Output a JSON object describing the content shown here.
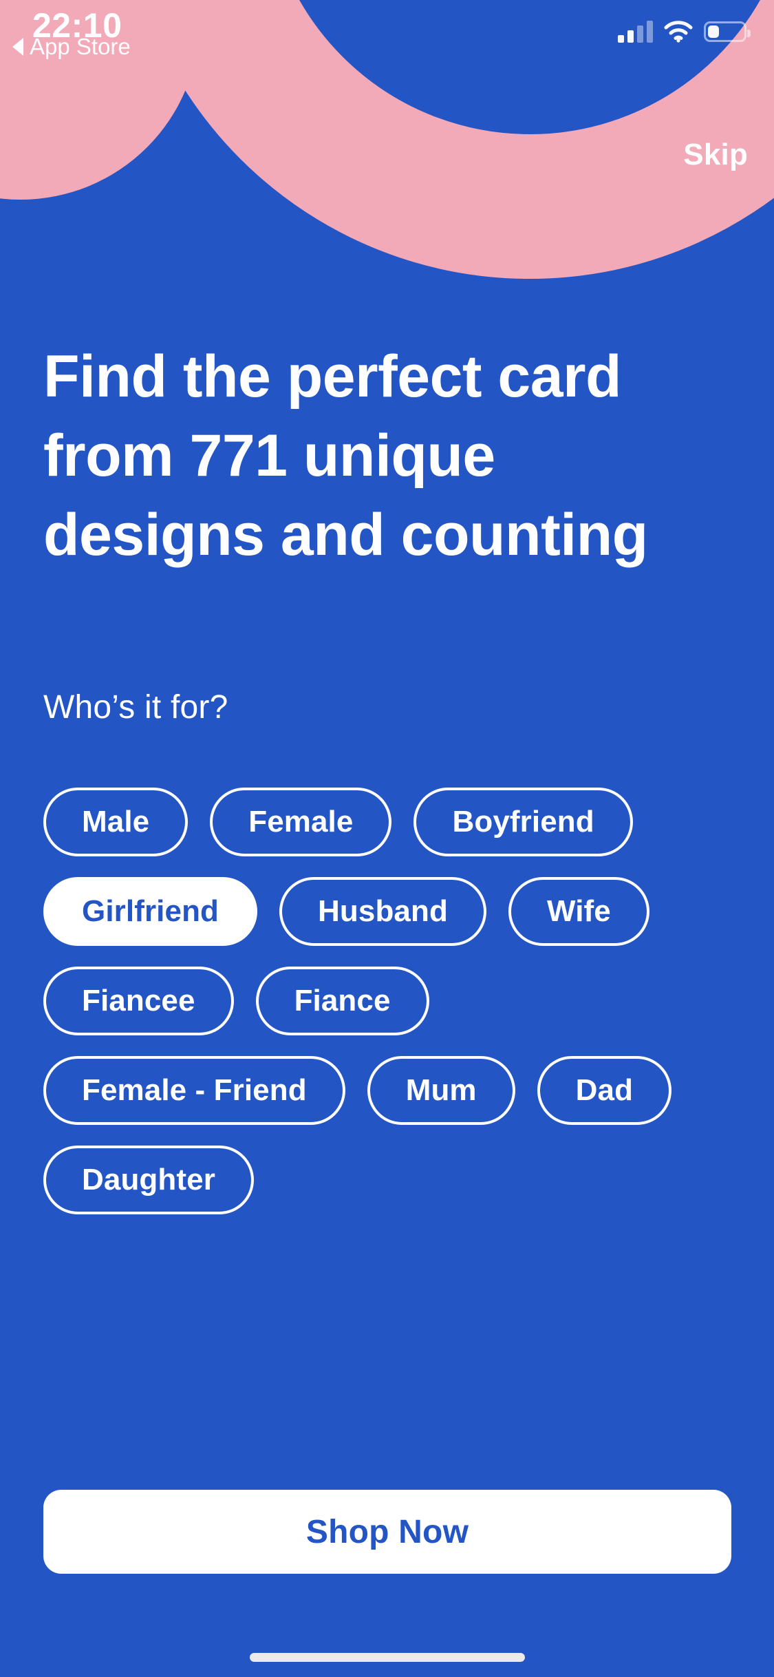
{
  "theme": {
    "background_blue": "#2455C4",
    "decoration_pink": "#F2A9B8",
    "surface_white": "#FFFFFF"
  },
  "status_bar": {
    "time": "22:10",
    "back_label": "App Store",
    "back_icon": "back-triangle-icon",
    "signal_icon": "cellular-signal-icon",
    "signal_bars_filled": 2,
    "signal_bars_total": 4,
    "wifi_icon": "wifi-icon",
    "battery_icon": "battery-icon",
    "battery_percent": 32
  },
  "header": {
    "skip_label": "Skip"
  },
  "main": {
    "headline": "Find the perfect card from 771 unique designs and counting",
    "card_count": 771,
    "question_label": "Who’s it for?",
    "chips": [
      {
        "label": "Male",
        "selected": false
      },
      {
        "label": "Female",
        "selected": false
      },
      {
        "label": "Boyfriend",
        "selected": false
      },
      {
        "label": "Girlfriend",
        "selected": true
      },
      {
        "label": "Husband",
        "selected": false
      },
      {
        "label": "Wife",
        "selected": false
      },
      {
        "label": "Fiancee",
        "selected": false
      },
      {
        "label": "Fiance",
        "selected": false
      },
      {
        "label": "Female - Friend",
        "selected": false
      },
      {
        "label": "Mum",
        "selected": false
      },
      {
        "label": "Dad",
        "selected": false
      },
      {
        "label": "Daughter",
        "selected": false
      }
    ]
  },
  "footer": {
    "shop_now_label": "Shop Now",
    "home_indicator": "home-indicator"
  }
}
